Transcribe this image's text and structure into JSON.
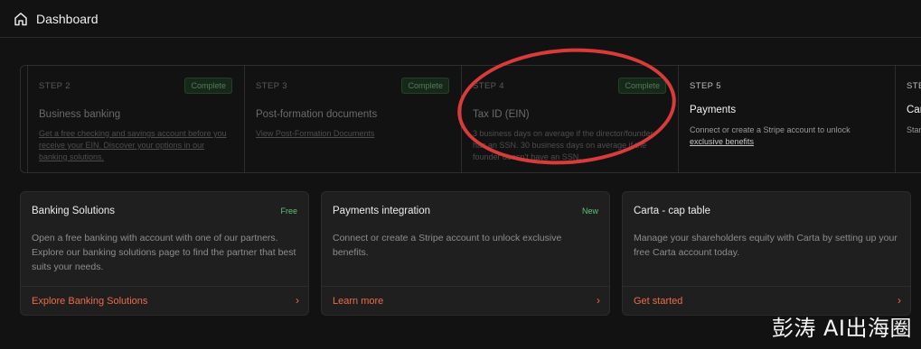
{
  "header": {
    "title": "Dashboard",
    "icon": "home-icon"
  },
  "steps": [
    {
      "num": "STEP 2",
      "title": "Business banking",
      "badge": "Complete",
      "desc": "Get a free checking and savings account before you receive your EIN. Discover your options in our banking solutions."
    },
    {
      "num": "STEP 3",
      "title": "Post-formation documents",
      "badge": "Complete",
      "desc": "View Post-Formation Documents"
    },
    {
      "num": "STEP 4",
      "title": "Tax ID (EIN)",
      "badge": "Complete",
      "desc": "3 business days on average if the director/founder has an SSN. 30 business days on average if the founder doesn't have an SSN."
    },
    {
      "num": "STEP 5",
      "title": "Payments",
      "desc": "Connect or create a Stripe account to unlock",
      "link": "exclusive benefits"
    },
    {
      "num": "STE",
      "title": "Car",
      "desc": "Star sett"
    }
  ],
  "cards": [
    {
      "title": "Banking Solutions",
      "tag": "Free",
      "body": "Open a free banking with account with one of our partners. Explore our banking solutions page to find the partner that best suits your needs.",
      "link": "Explore Banking Solutions",
      "arrow": "›"
    },
    {
      "title": "Payments integration",
      "tag": "New",
      "body": "Connect or create a Stripe account to unlock exclusive benefits.",
      "link": "Learn more",
      "arrow": "›"
    },
    {
      "title": "Carta - cap table",
      "tag": "",
      "body": "Manage your shareholders equity with Carta by setting up your free Carta account today.",
      "link": "Get started",
      "arrow": "›"
    }
  ],
  "watermark": "彭涛 AI出海圈",
  "colors": {
    "accent": "#ef6a4a",
    "success": "#61c07a",
    "annotation": "#d93b3b"
  }
}
